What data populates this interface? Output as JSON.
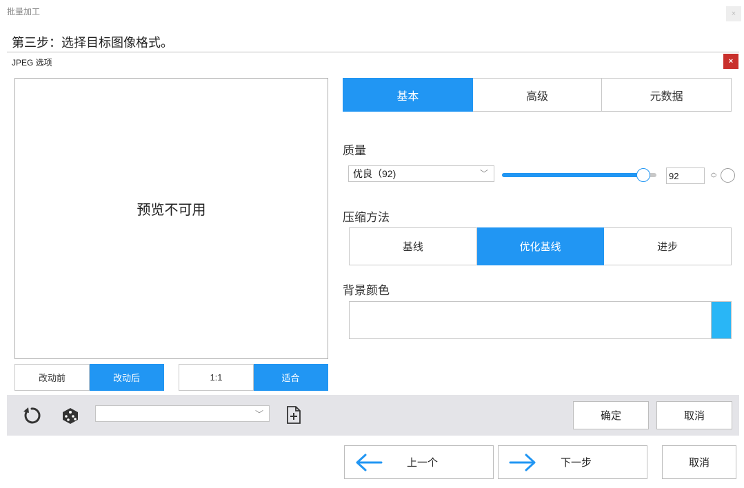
{
  "window": {
    "title": "批量加工",
    "close": "×"
  },
  "step": {
    "title": "第三步：选择目标图像格式。"
  },
  "dialog": {
    "title": "JPEG 选项",
    "close": "×"
  },
  "preview": {
    "message": "预览不可用",
    "compare": [
      "改动前",
      "改动后"
    ],
    "compare_active": 1,
    "zoom": [
      "1:1",
      "适合"
    ],
    "zoom_active": 1
  },
  "tabs": {
    "items": [
      "基本",
      "高级",
      "元数据"
    ],
    "active": 0
  },
  "quality": {
    "label": "质量",
    "preset": "优良（92)",
    "value": "92",
    "slider_percent": 92
  },
  "method": {
    "label": "压缩方法",
    "items": [
      "基线",
      "优化基线",
      "进步"
    ],
    "active": 1
  },
  "background": {
    "label": "背景颜色",
    "swatch_color": "#29b6f6"
  },
  "toolbar": {
    "preset_value": "",
    "ok": "确定",
    "cancel": "取消"
  },
  "footer": {
    "prev": "上一个",
    "next": "下一步",
    "cancel": "取消"
  },
  "colors": {
    "accent": "#2196f3",
    "close_red": "#c9302c"
  },
  "icons": [
    "reset-icon",
    "dice-icon",
    "new-preset-icon",
    "arrow-left-icon",
    "arrow-right-icon"
  ]
}
